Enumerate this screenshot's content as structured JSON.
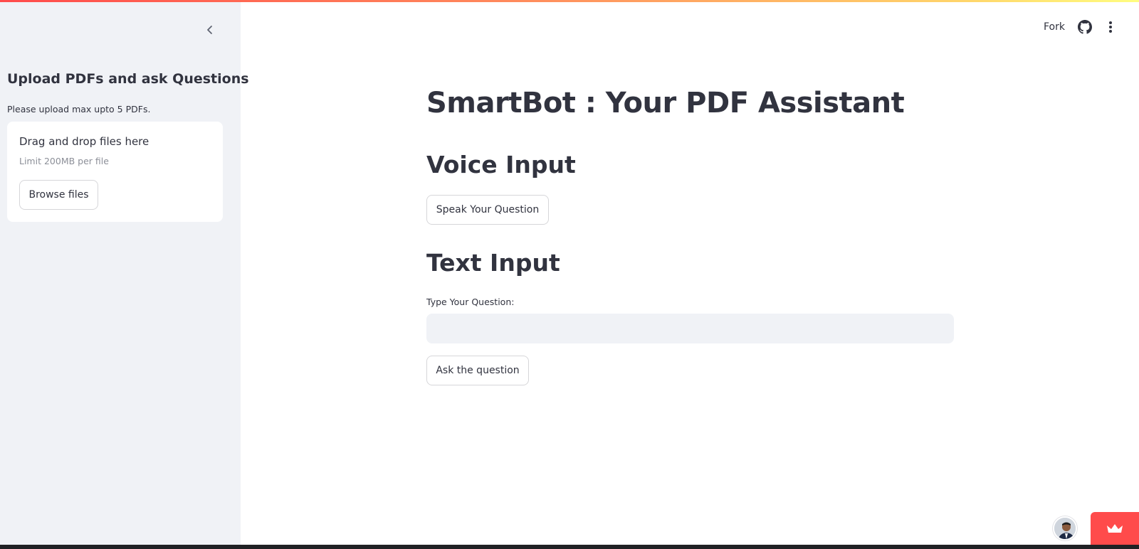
{
  "sidebar": {
    "collapse_icon": "chevron-left-icon",
    "title": "Upload PDFs and ask Questions",
    "note": "Please upload max upto 5 PDFs.",
    "uploader": {
      "drop_text": "Drag and drop files here",
      "limit_text": "Limit 200MB per file",
      "browse_label": "Browse files"
    }
  },
  "header": {
    "fork_label": "Fork",
    "github_icon": "github-icon",
    "menu_icon": "more-vertical-icon"
  },
  "main": {
    "title": "SmartBot : Your PDF Assistant",
    "voice_section": {
      "heading": "Voice Input",
      "button_label": "Speak Your Question"
    },
    "text_section": {
      "heading": "Text Input",
      "input_label": "Type Your Question:",
      "input_value": "",
      "button_label": "Ask the question"
    }
  },
  "footer": {
    "avatar_icon": "user-avatar",
    "badge_icon": "crown-icon"
  },
  "colors": {
    "sidebar_bg": "#f0f2f6",
    "text": "#31333f",
    "muted_text": "#8c8f98",
    "accent_red": "#ff4b4b",
    "button_border": "#d6d6d9"
  }
}
